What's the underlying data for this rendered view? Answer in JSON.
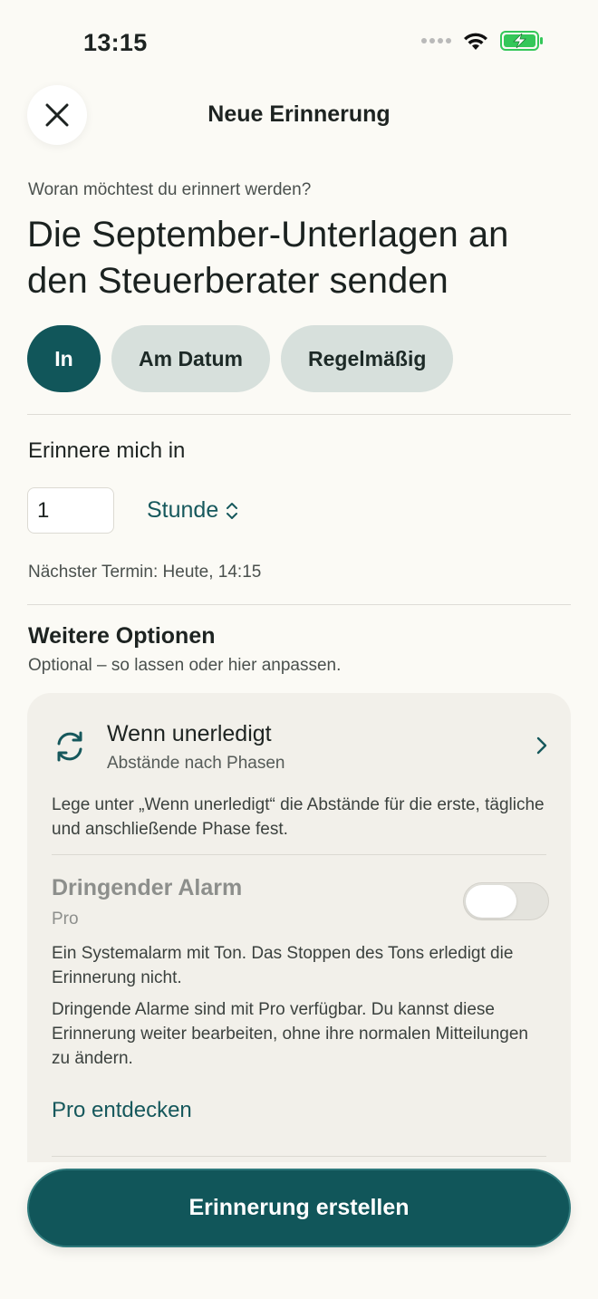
{
  "status_bar": {
    "time": "13:15"
  },
  "header": {
    "title": "Neue Erinnerung",
    "close_icon": "close-icon"
  },
  "form": {
    "question": "Woran möchtest du erinnert werden?",
    "reminder_text": "Die September-Unterlagen an den Steuerberater senden",
    "segments": [
      {
        "label": "In",
        "selected": true
      },
      {
        "label": "Am Datum",
        "selected": false
      },
      {
        "label": "Regelmäßig",
        "selected": false
      }
    ],
    "remind_label": "Erinnere mich in",
    "amount_value": "1",
    "unit_value": "Stunde",
    "next_date": "Nächster Termin: Heute, 14:15"
  },
  "more_options": {
    "title": "Weitere Optionen",
    "subtitle": "Optional – so lassen oder hier anpassen.",
    "if_undone": {
      "title": "Wenn unerledigt",
      "subtitle": "Abstände nach Phasen",
      "description": "Lege unter „Wenn unerledigt“ die Abstände für die erste, tägliche und anschließende Phase fest."
    },
    "urgent_alarm": {
      "title": "Dringender Alarm",
      "badge": "Pro",
      "enabled": false,
      "description_1": "Ein Systemalarm mit Ton. Das Stoppen des Tons erledigt die Erinnerung nicht.",
      "description_2": "Dringende Alarme sind mit Pro verfügbar. Du kannst diese Erinnerung weiter bearbeiten, ohne ihre normalen Mitteilungen zu ändern.",
      "link": "Pro entdecken"
    }
  },
  "footer": {
    "create_button": "Erinnerung erstellen"
  },
  "colors": {
    "accent": "#11565a",
    "background": "#fbfaf5",
    "card": "#f2f0ea",
    "chip_inactive": "#d7e0dc"
  }
}
